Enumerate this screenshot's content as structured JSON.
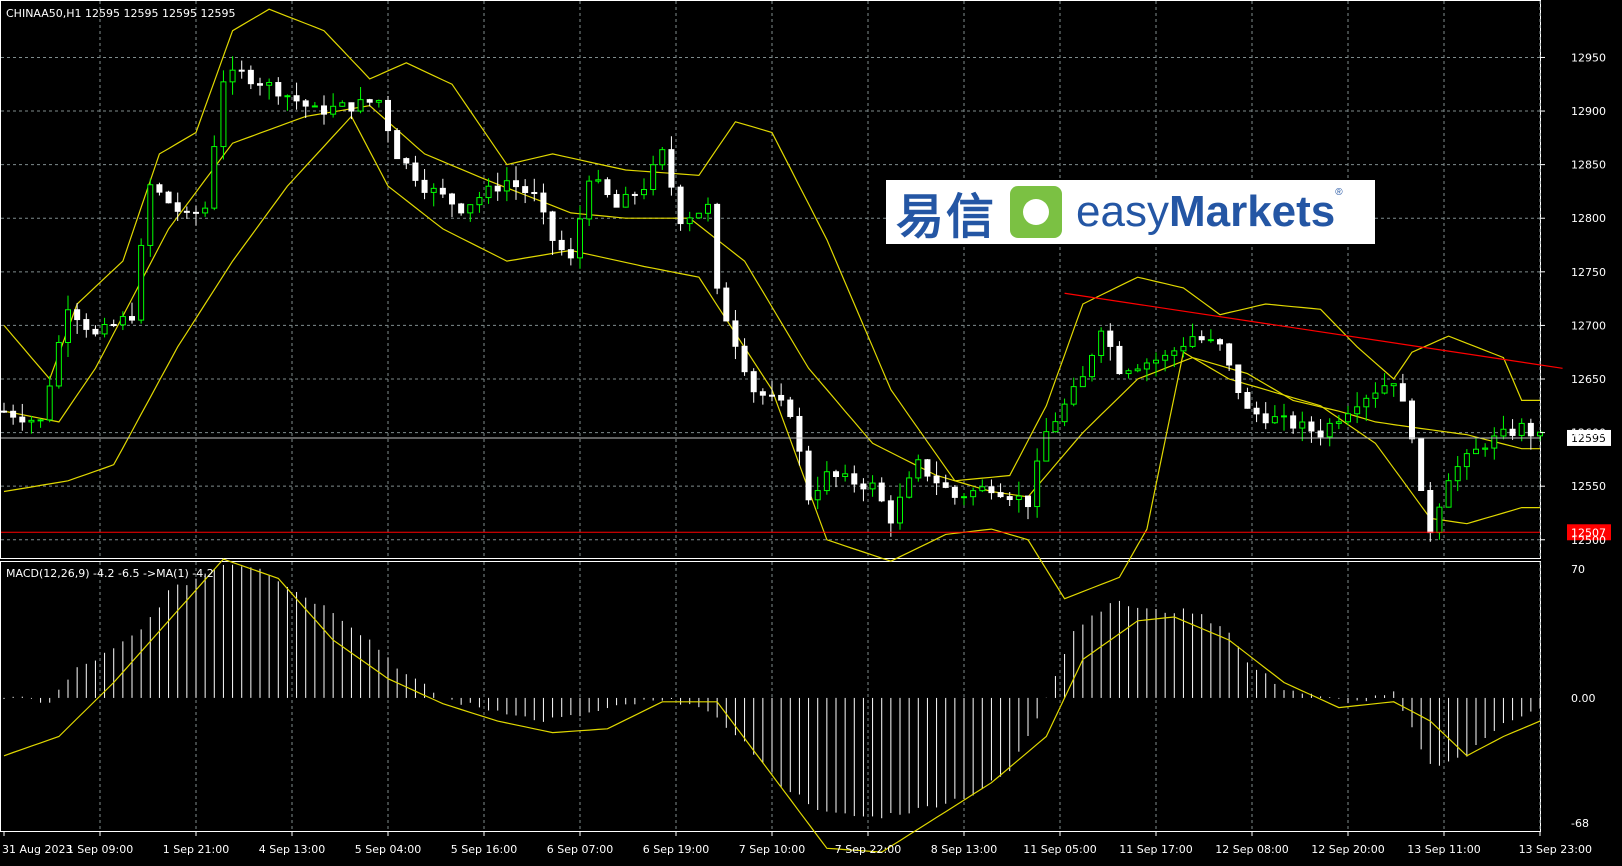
{
  "header": {
    "symbol_info": "CHINAA50,H1  12595 12595 12595 12595",
    "macd_label": "MACD(12,26,9) -4.2 -6.5  ->MA(1) -4.2"
  },
  "logo": {
    "cn": "易信",
    "en_easy": "easy",
    "en_markets": "Markets",
    "reg": "®"
  },
  "colors": {
    "background": "#000000",
    "grid": "#7f8c8d",
    "bull_candle": "#00ff00",
    "bear_candle": "#ffffff",
    "bands": "#e0d800",
    "trendline": "#ff0000",
    "price_line": "#c0c0c0"
  },
  "chart_data": [
    {
      "type": "candlestick",
      "title": "CHINAA50,H1",
      "price_range": [
        12483,
        12998
      ],
      "y_ticks": [
        12500,
        12550,
        12600,
        12650,
        12700,
        12750,
        12800,
        12850,
        12900,
        12950
      ],
      "x_ticks": [
        "31 Aug 2023",
        "1 Sep 09:00",
        "1 Sep 21:00",
        "4 Sep 13:00",
        "5 Sep 04:00",
        "5 Sep 16:00",
        "6 Sep 07:00",
        "6 Sep 19:00",
        "7 Sep 10:00",
        "7 Sep 22:00",
        "8 Sep 13:00",
        "11 Sep 05:00",
        "11 Sep 17:00",
        "12 Sep 08:00",
        "12 Sep 20:00",
        "13 Sep 11:00",
        "13 Sep 23:00"
      ],
      "current_price": {
        "value": 12595,
        "label": "12595"
      },
      "support_line": {
        "value": 12507,
        "label": "12507"
      },
      "trendline": {
        "start": {
          "index": 116,
          "price": 12730
        },
        "end": {
          "index": 165,
          "price": 12660
        }
      },
      "close_anchors": [
        [
          0,
          12620
        ],
        [
          4,
          12610
        ],
        [
          7,
          12720
        ],
        [
          10,
          12690
        ],
        [
          14,
          12710
        ],
        [
          16,
          12830
        ],
        [
          20,
          12800
        ],
        [
          22,
          12810
        ],
        [
          24,
          12930
        ],
        [
          26,
          12935
        ],
        [
          30,
          12920
        ],
        [
          34,
          12900
        ],
        [
          38,
          12905
        ],
        [
          41,
          12910
        ],
        [
          43,
          12860
        ],
        [
          46,
          12830
        ],
        [
          50,
          12810
        ],
        [
          55,
          12835
        ],
        [
          58,
          12820
        ],
        [
          60,
          12780
        ],
        [
          62,
          12760
        ],
        [
          64,
          12840
        ],
        [
          67,
          12810
        ],
        [
          70,
          12830
        ],
        [
          72,
          12860
        ],
        [
          74,
          12800
        ],
        [
          77,
          12810
        ],
        [
          78,
          12730
        ],
        [
          82,
          12640
        ],
        [
          86,
          12620
        ],
        [
          88,
          12540
        ],
        [
          90,
          12560
        ],
        [
          95,
          12550
        ],
        [
          97,
          12520
        ],
        [
          100,
          12570
        ],
        [
          104,
          12540
        ],
        [
          108,
          12550
        ],
        [
          112,
          12535
        ],
        [
          114,
          12600
        ],
        [
          118,
          12650
        ],
        [
          120,
          12700
        ],
        [
          122,
          12660
        ],
        [
          127,
          12670
        ],
        [
          130,
          12690
        ],
        [
          133,
          12680
        ],
        [
          136,
          12620
        ],
        [
          140,
          12610
        ],
        [
          144,
          12600
        ],
        [
          148,
          12630
        ],
        [
          152,
          12650
        ],
        [
          154,
          12600
        ],
        [
          155,
          12540
        ],
        [
          156,
          12510
        ],
        [
          158,
          12560
        ],
        [
          162,
          12590
        ],
        [
          166,
          12605
        ],
        [
          168,
          12595
        ]
      ],
      "upper_band": [
        [
          0,
          12700
        ],
        [
          5,
          12650
        ],
        [
          8,
          12720
        ],
        [
          13,
          12760
        ],
        [
          17,
          12860
        ],
        [
          21,
          12880
        ],
        [
          25,
          12975
        ],
        [
          29,
          12995
        ],
        [
          35,
          12975
        ],
        [
          40,
          12930
        ],
        [
          44,
          12945
        ],
        [
          49,
          12925
        ],
        [
          55,
          12850
        ],
        [
          60,
          12860
        ],
        [
          68,
          12845
        ],
        [
          76,
          12840
        ],
        [
          80,
          12890
        ],
        [
          84,
          12880
        ],
        [
          90,
          12780
        ],
        [
          97,
          12640
        ],
        [
          104,
          12555
        ],
        [
          110,
          12560
        ],
        [
          114,
          12625
        ],
        [
          118,
          12720
        ],
        [
          124,
          12745
        ],
        [
          129,
          12735
        ],
        [
          133,
          12710
        ],
        [
          138,
          12720
        ],
        [
          144,
          12715
        ],
        [
          148,
          12680
        ],
        [
          152,
          12650
        ],
        [
          154,
          12675
        ],
        [
          158,
          12690
        ],
        [
          164,
          12670
        ],
        [
          166,
          12630
        ]
      ],
      "middle_band": [
        [
          0,
          12620
        ],
        [
          6,
          12610
        ],
        [
          10,
          12660
        ],
        [
          18,
          12790
        ],
        [
          25,
          12870
        ],
        [
          33,
          12895
        ],
        [
          40,
          12905
        ],
        [
          46,
          12860
        ],
        [
          53,
          12835
        ],
        [
          62,
          12805
        ],
        [
          68,
          12800
        ],
        [
          75,
          12800
        ],
        [
          81,
          12760
        ],
        [
          88,
          12660
        ],
        [
          95,
          12590
        ],
        [
          102,
          12560
        ],
        [
          108,
          12545
        ],
        [
          112,
          12540
        ],
        [
          118,
          12600
        ],
        [
          124,
          12650
        ],
        [
          130,
          12670
        ],
        [
          136,
          12655
        ],
        [
          141,
          12630
        ],
        [
          146,
          12620
        ],
        [
          150,
          12610
        ],
        [
          154,
          12605
        ],
        [
          160,
          12598
        ],
        [
          166,
          12585
        ]
      ],
      "lower_band": [
        [
          0,
          12545
        ],
        [
          7,
          12555
        ],
        [
          12,
          12570
        ],
        [
          19,
          12680
        ],
        [
          25,
          12760
        ],
        [
          31,
          12830
        ],
        [
          38,
          12895
        ],
        [
          42,
          12830
        ],
        [
          48,
          12790
        ],
        [
          55,
          12760
        ],
        [
          62,
          12770
        ],
        [
          70,
          12755
        ],
        [
          76,
          12745
        ],
        [
          84,
          12640
        ],
        [
          90,
          12500
        ],
        [
          97,
          12480
        ],
        [
          103,
          12505
        ],
        [
          108,
          12510
        ],
        [
          112,
          12500
        ],
        [
          116,
          12445
        ],
        [
          122,
          12465
        ],
        [
          125,
          12510
        ],
        [
          129,
          12675
        ],
        [
          134,
          12650
        ],
        [
          138,
          12640
        ],
        [
          144,
          12625
        ],
        [
          150,
          12590
        ],
        [
          153,
          12555
        ],
        [
          156,
          12520
        ],
        [
          160,
          12515
        ],
        [
          166,
          12530
        ]
      ]
    },
    {
      "type": "histogram+line",
      "title": "MACD(12,26,9) -4.2 -6.5  ->MA(1) -4.2",
      "y_range": [
        -68,
        70
      ],
      "y_ticks": [
        {
          "value": 70,
          "label": "70"
        },
        {
          "value": 0,
          "label": "0.00"
        },
        {
          "value": -68,
          "label": "-68"
        }
      ],
      "main_anchors": [
        [
          0,
          0
        ],
        [
          5,
          -2
        ],
        [
          8,
          15
        ],
        [
          12,
          25
        ],
        [
          15,
          35
        ],
        [
          18,
          55
        ],
        [
          21,
          62
        ],
        [
          24,
          70
        ],
        [
          28,
          68
        ],
        [
          32,
          55
        ],
        [
          36,
          45
        ],
        [
          40,
          30
        ],
        [
          44,
          12
        ],
        [
          48,
          0
        ],
        [
          52,
          -5
        ],
        [
          56,
          -8
        ],
        [
          58,
          -12
        ],
        [
          62,
          -10
        ],
        [
          66,
          -6
        ],
        [
          70,
          -2
        ],
        [
          75,
          -2
        ],
        [
          80,
          -18
        ],
        [
          85,
          -45
        ],
        [
          90,
          -60
        ],
        [
          95,
          -62
        ],
        [
          100,
          -58
        ],
        [
          106,
          -50
        ],
        [
          110,
          -38
        ],
        [
          113,
          -10
        ],
        [
          117,
          35
        ],
        [
          121,
          50
        ],
        [
          126,
          45
        ],
        [
          130,
          45
        ],
        [
          134,
          35
        ],
        [
          136,
          18
        ],
        [
          140,
          5
        ],
        [
          144,
          0
        ],
        [
          148,
          -2
        ],
        [
          152,
          2
        ],
        [
          156,
          -35
        ],
        [
          160,
          -30
        ],
        [
          164,
          -12
        ],
        [
          168,
          -6
        ]
      ],
      "signal_anchors": [
        [
          0,
          -30
        ],
        [
          6,
          -20
        ],
        [
          12,
          8
        ],
        [
          18,
          40
        ],
        [
          24,
          72
        ],
        [
          30,
          62
        ],
        [
          36,
          30
        ],
        [
          42,
          10
        ],
        [
          48,
          -3
        ],
        [
          54,
          -12
        ],
        [
          60,
          -18
        ],
        [
          66,
          -16
        ],
        [
          72,
          -2
        ],
        [
          78,
          -2
        ],
        [
          84,
          -40
        ],
        [
          90,
          -78
        ],
        [
          96,
          -80
        ],
        [
          102,
          -62
        ],
        [
          108,
          -44
        ],
        [
          114,
          -20
        ],
        [
          118,
          20
        ],
        [
          124,
          40
        ],
        [
          128,
          42
        ],
        [
          134,
          30
        ],
        [
          140,
          8
        ],
        [
          146,
          -5
        ],
        [
          152,
          -2
        ],
        [
          156,
          -12
        ],
        [
          160,
          -30
        ],
        [
          164,
          -20
        ],
        [
          168,
          -12
        ]
      ]
    }
  ]
}
